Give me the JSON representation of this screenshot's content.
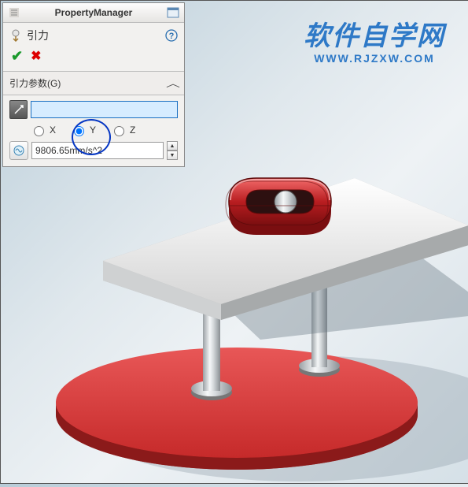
{
  "watermark": {
    "cn": "软件自学网",
    "en": "WWW.RJZXW.COM"
  },
  "panel": {
    "title": "PropertyManager",
    "feature_label": "引力",
    "section_label": "引力参数(G)",
    "axes": {
      "x": "X",
      "y": "Y",
      "z": "Z",
      "selected": "y"
    },
    "reference_value": "",
    "gravity_value": "9806.65mm/s^2"
  }
}
